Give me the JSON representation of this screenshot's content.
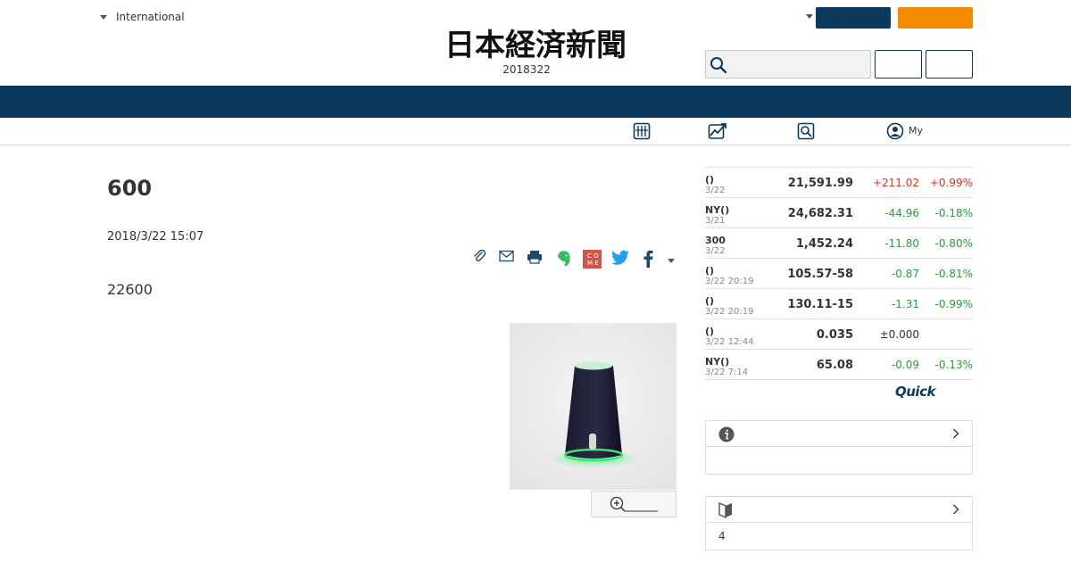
{
  "header": {
    "region_label": "International",
    "issue_date": "2018322",
    "logo_text": "日本経済新聞",
    "colors": {
      "navy": "#0b3a5e",
      "orange": "#f58b00"
    }
  },
  "subnav": {
    "mypage_label": "My"
  },
  "article": {
    "headline": "600",
    "date": "2018/3/22 15:07",
    "lead": "22600"
  },
  "market": {
    "rows": [
      {
        "name": "()",
        "time": "3/22",
        "value": "21,591.99",
        "change": "+211.02",
        "pct": "+0.99%",
        "dir": "up"
      },
      {
        "name": "NY()",
        "time": "3/21",
        "value": "24,682.31",
        "change": "-44.96",
        "pct": "-0.18%",
        "dir": "down"
      },
      {
        "name": "300",
        "time": "3/22",
        "value": "1,452.24",
        "change": "-11.80",
        "pct": "-0.80%",
        "dir": "down"
      },
      {
        "name": "()",
        "time": "3/22 20:19",
        "value": "105.57-58",
        "change": "-0.87",
        "pct": "-0.81%",
        "dir": "down"
      },
      {
        "name": "()",
        "time": "3/22 20:19",
        "value": "130.11-15",
        "change": "-1.31",
        "pct": "-0.99%",
        "dir": "down"
      },
      {
        "name": "()",
        "time": "3/22 12:44",
        "value": "0.035",
        "change": "±0.000",
        "pct": "",
        "dir": "flat"
      },
      {
        "name": "NY()",
        "time": "3/22 7:14",
        "value": "65.08",
        "change": "-0.09",
        "pct": "-0.13%",
        "dir": "down"
      }
    ],
    "provider": "Quick",
    "colors": {
      "up": "#e0301e",
      "down": "#2e9a3e"
    }
  },
  "panels": [
    {
      "body": ""
    },
    {
      "body": "4"
    }
  ]
}
